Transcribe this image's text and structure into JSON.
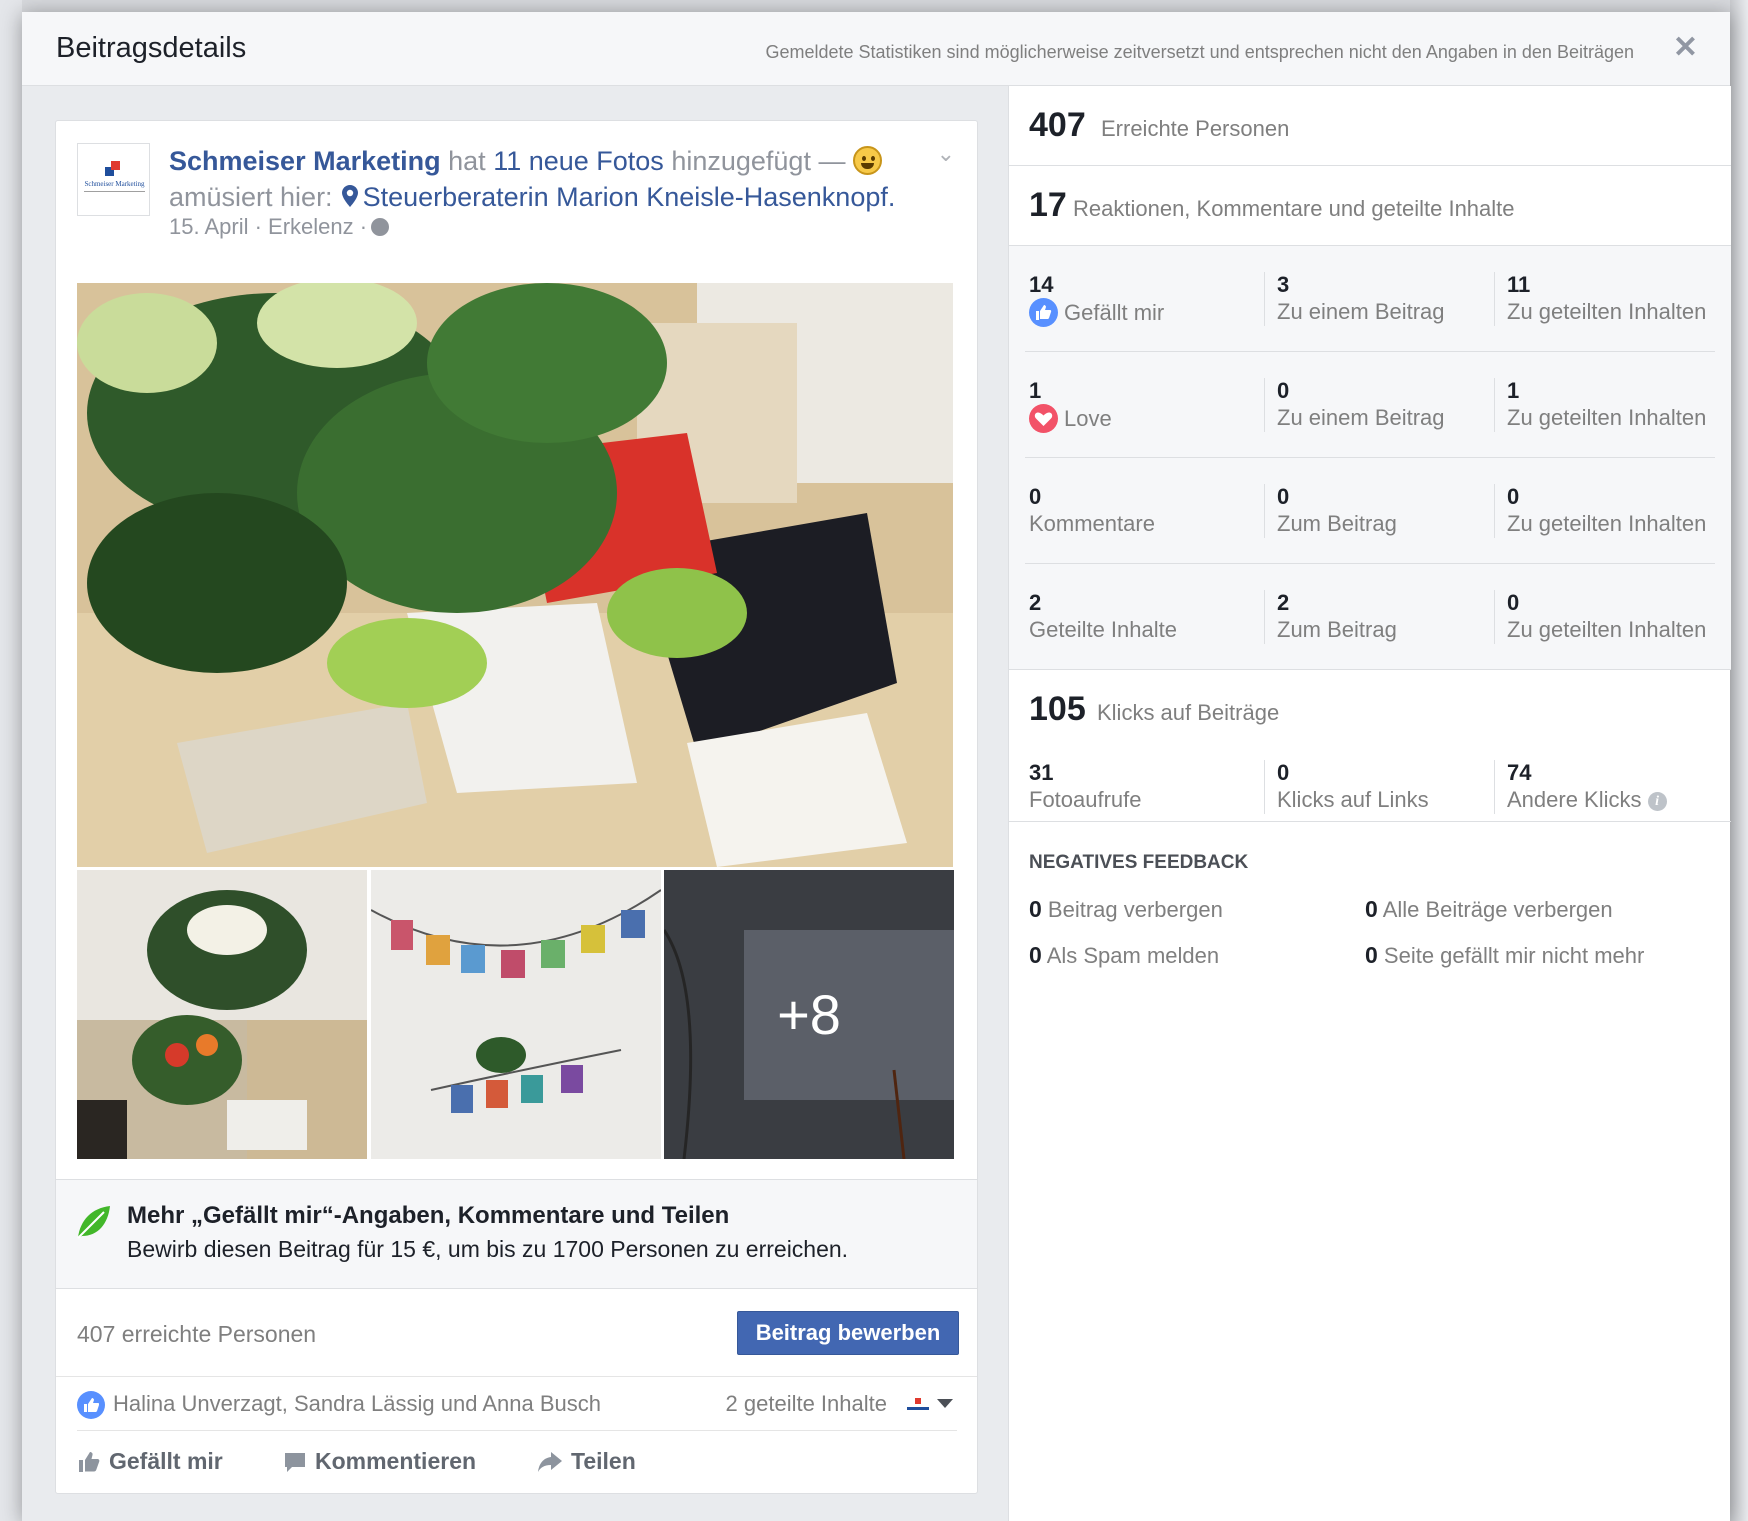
{
  "dialog": {
    "title": "Beitragsdetails",
    "note": "Gemeldete Statistiken sind möglicherweise zeitversetzt und entsprechen nicht den Angaben in den Beiträgen",
    "close_label": "✕"
  },
  "post": {
    "avatar_text": "Schmeiser Marketing",
    "author": "Schmeiser Marketing",
    "action_prefix": "hat",
    "photos_link": "11 neue Fotos",
    "action_suffix": "hinzugefügt —",
    "feeling": "amüsiert hier:",
    "location": "Steuerberaterin Marion Kneisle-Hasenknopf.",
    "date": "15. April · Erkelenz ·",
    "more_photos": "+8"
  },
  "promo": {
    "title": "Mehr „Gefällt mir“-Angaben, Kommentare und Teilen",
    "text": "Bewirb diesen Beitrag für 15 €, um bis zu 1700 Personen zu erreichen."
  },
  "reach_footer": {
    "text": "407 erreichte Personen",
    "boost_button": "Beitrag bewerben"
  },
  "likers": {
    "names": "Halina Unverzagt, Sandra Lässig und Anna Busch",
    "shares": "2 geteilte Inhalte"
  },
  "actions": {
    "like": "Gefällt mir",
    "comment": "Kommentieren",
    "share": "Teilen"
  },
  "stats": {
    "reach": {
      "value": "407",
      "label": "Erreichte Personen"
    },
    "engagement": {
      "value": "17",
      "label": "Reaktionen, Kommentare und geteilte Inhalte"
    },
    "rows": [
      {
        "c1": {
          "n": "14",
          "l": "Gefällt mir"
        },
        "c2": {
          "n": "3",
          "l": "Zu einem Beitrag"
        },
        "c3": {
          "n": "11",
          "l": "Zu geteilten Inhalten"
        }
      },
      {
        "c1": {
          "n": "1",
          "l": "Love"
        },
        "c2": {
          "n": "0",
          "l": "Zu einem Beitrag"
        },
        "c3": {
          "n": "1",
          "l": "Zu geteilten Inhalten"
        }
      },
      {
        "c1": {
          "n": "0",
          "l": "Kommentare"
        },
        "c2": {
          "n": "0",
          "l": "Zum Beitrag"
        },
        "c3": {
          "n": "0",
          "l": "Zu geteilten Inhalten"
        }
      },
      {
        "c1": {
          "n": "2",
          "l": "Geteilte Inhalte"
        },
        "c2": {
          "n": "2",
          "l": "Zum Beitrag"
        },
        "c3": {
          "n": "0",
          "l": "Zu geteilten Inhalten"
        }
      }
    ],
    "clicks": {
      "value": "105",
      "label": "Klicks auf Beiträge",
      "photo_views": {
        "n": "31",
        "l": "Fotoaufrufe"
      },
      "link_clicks": {
        "n": "0",
        "l": "Klicks auf Links"
      },
      "other_clicks": {
        "n": "74",
        "l": "Andere Klicks"
      }
    },
    "negative": {
      "title": "NEGATIVES FEEDBACK",
      "hide_post": {
        "n": "0",
        "l": "Beitrag verbergen"
      },
      "hide_all": {
        "n": "0",
        "l": "Alle Beiträge verbergen"
      },
      "spam": {
        "n": "0",
        "l": "Als Spam melden"
      },
      "unlike": {
        "n": "0",
        "l": "Seite gefällt mir nicht mehr"
      }
    }
  },
  "colors": {
    "link": "#365899",
    "button": "#4267b2",
    "like": "#5890ff",
    "love": "#f25268"
  }
}
